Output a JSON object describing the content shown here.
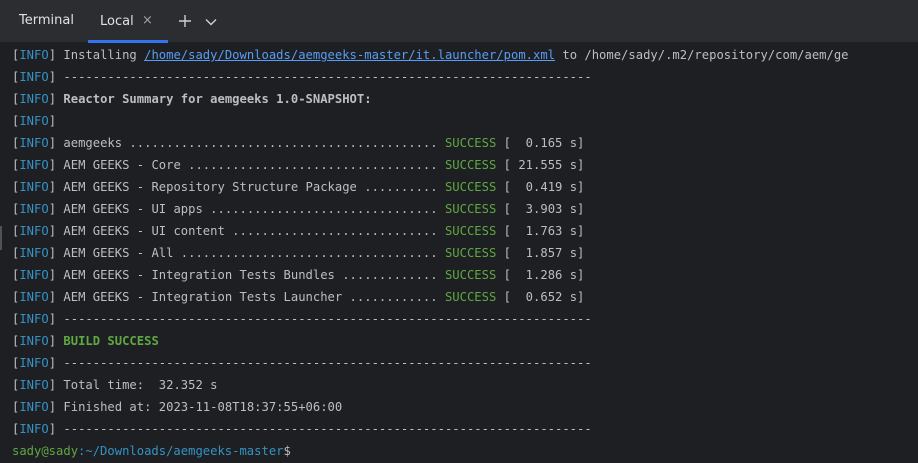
{
  "header": {
    "title": "Terminal",
    "tab_label": "Local",
    "close_glyph": "×",
    "new_tab_icon": "plus-icon",
    "dropdown_icon": "chevron-down-icon"
  },
  "colors": {
    "info": "#3592c4",
    "success": "#5fa843",
    "link": "#589df6",
    "background": "#1e1f22",
    "tab_accent": "#3574f0"
  },
  "log": {
    "info_tag": "INFO",
    "installing_text": "Installing ",
    "installing_link": "/home/sady/Downloads/aemgeeks-master/it.launcher/pom.xml",
    "installing_dest": " to /home/sady/.m2/repository/com/aem/ge",
    "separator": "------------------------------------------------------------------------",
    "reactor_title": "Reactor Summary for aemgeeks 1.0-SNAPSHOT:",
    "modules": [
      {
        "name": "aemgeeks ..........................................",
        "status": "SUCCESS",
        "time": "[  0.165 s]"
      },
      {
        "name": "AEM GEEKS - Core ..................................",
        "status": "SUCCESS",
        "time": "[ 21.555 s]"
      },
      {
        "name": "AEM GEEKS - Repository Structure Package ..........",
        "status": "SUCCESS",
        "time": "[  0.419 s]"
      },
      {
        "name": "AEM GEEKS - UI apps ...............................",
        "status": "SUCCESS",
        "time": "[  3.903 s]"
      },
      {
        "name": "AEM GEEKS - UI content ............................",
        "status": "SUCCESS",
        "time": "[  1.763 s]"
      },
      {
        "name": "AEM GEEKS - All ...................................",
        "status": "SUCCESS",
        "time": "[  1.857 s]"
      },
      {
        "name": "AEM GEEKS - Integration Tests Bundles .............",
        "status": "SUCCESS",
        "time": "[  1.286 s]"
      },
      {
        "name": "AEM GEEKS - Integration Tests Launcher ............",
        "status": "SUCCESS",
        "time": "[  0.652 s]"
      }
    ],
    "build_result": "BUILD SUCCESS",
    "total_time": "Total time:  32.352 s",
    "finished_at": "Finished at: 2023-11-08T18:37:55+06:00"
  },
  "prompt": {
    "user_host": "sady@sady",
    "path": ":~/Downloads/aemgeeks-master",
    "symbol": "$"
  }
}
